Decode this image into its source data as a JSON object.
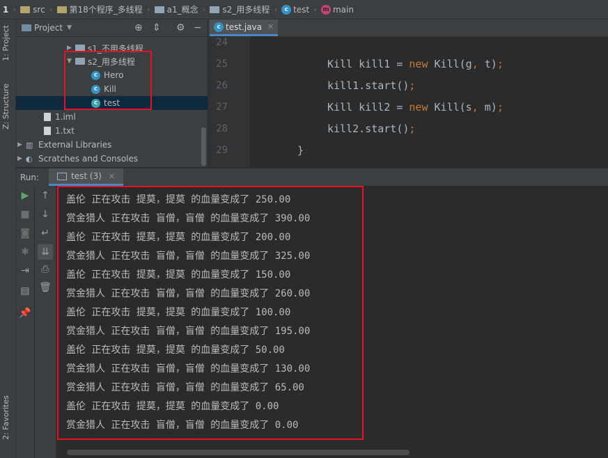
{
  "breadcrumb": [
    {
      "label": "1",
      "icon": "none"
    },
    {
      "label": "src",
      "icon": "folder-icon"
    },
    {
      "label": "第18个程序_多线程",
      "icon": "folder-icon"
    },
    {
      "label": "a1_概念",
      "icon": "package-icon"
    },
    {
      "label": "s2_用多线程",
      "icon": "package-icon"
    },
    {
      "label": "test",
      "icon": "class-icon"
    },
    {
      "label": "main",
      "icon": "method-icon"
    }
  ],
  "left_strip": {
    "project": "1: Project",
    "structure": "Z: Structure",
    "favorites": "2: Favorites"
  },
  "project_panel": {
    "title": "Project",
    "tree": [
      {
        "label": "s1_不用多线程",
        "type": "package",
        "expanded": false
      },
      {
        "label": "s2_用多线程",
        "type": "package",
        "expanded": true
      },
      {
        "label": "Hero",
        "type": "class"
      },
      {
        "label": "Kill",
        "type": "class"
      },
      {
        "label": "test",
        "type": "class-runnable",
        "selected": true
      },
      {
        "label": "1.iml",
        "type": "file"
      },
      {
        "label": "1.txt",
        "type": "file"
      },
      {
        "label": "External Libraries",
        "type": "libs"
      },
      {
        "label": "Scratches and Consoles",
        "type": "scratch"
      }
    ]
  },
  "editor": {
    "tab": "test.java",
    "lines": [
      {
        "num": "24",
        "code": ""
      },
      {
        "num": "25",
        "code": "Kill kill1 = new Kill(g, t);"
      },
      {
        "num": "26",
        "code": "kill1.start();"
      },
      {
        "num": "27",
        "code": "Kill kill2 = new Kill(s, m);"
      },
      {
        "num": "28",
        "code": "kill2.start();"
      },
      {
        "num": "29",
        "code": "}"
      }
    ]
  },
  "run_panel": {
    "label": "Run:",
    "tab": "test (3)",
    "output": [
      "盖伦 正在攻击 提莫，提莫 的血量变成了 250.00",
      "赏金猎人 正在攻击 盲僧，盲僧 的血量变成了 390.00",
      "盖伦 正在攻击 提莫，提莫 的血量变成了 200.00",
      "赏金猎人 正在攻击 盲僧，盲僧 的血量变成了 325.00",
      "盖伦 正在攻击 提莫，提莫 的血量变成了 150.00",
      "赏金猎人 正在攻击 盲僧，盲僧 的血量变成了 260.00",
      "盖伦 正在攻击 提莫，提莫 的血量变成了 100.00",
      "赏金猎人 正在攻击 盲僧，盲僧 的血量变成了 195.00",
      "盖伦 正在攻击 提莫，提莫 的血量变成了 50.00",
      "赏金猎人 正在攻击 盲僧，盲僧 的血量变成了 130.00",
      "赏金猎人 正在攻击 盲僧，盲僧 的血量变成了 65.00",
      "盖伦 正在攻击 提莫，提莫 的血量变成了 0.00",
      "赏金猎人 正在攻击 盲僧，盲僧 的血量变成了 0.00"
    ]
  },
  "colors": {
    "highlight_box": "#e81123",
    "keyword": "#cc7832",
    "selection": "#0d293e"
  }
}
